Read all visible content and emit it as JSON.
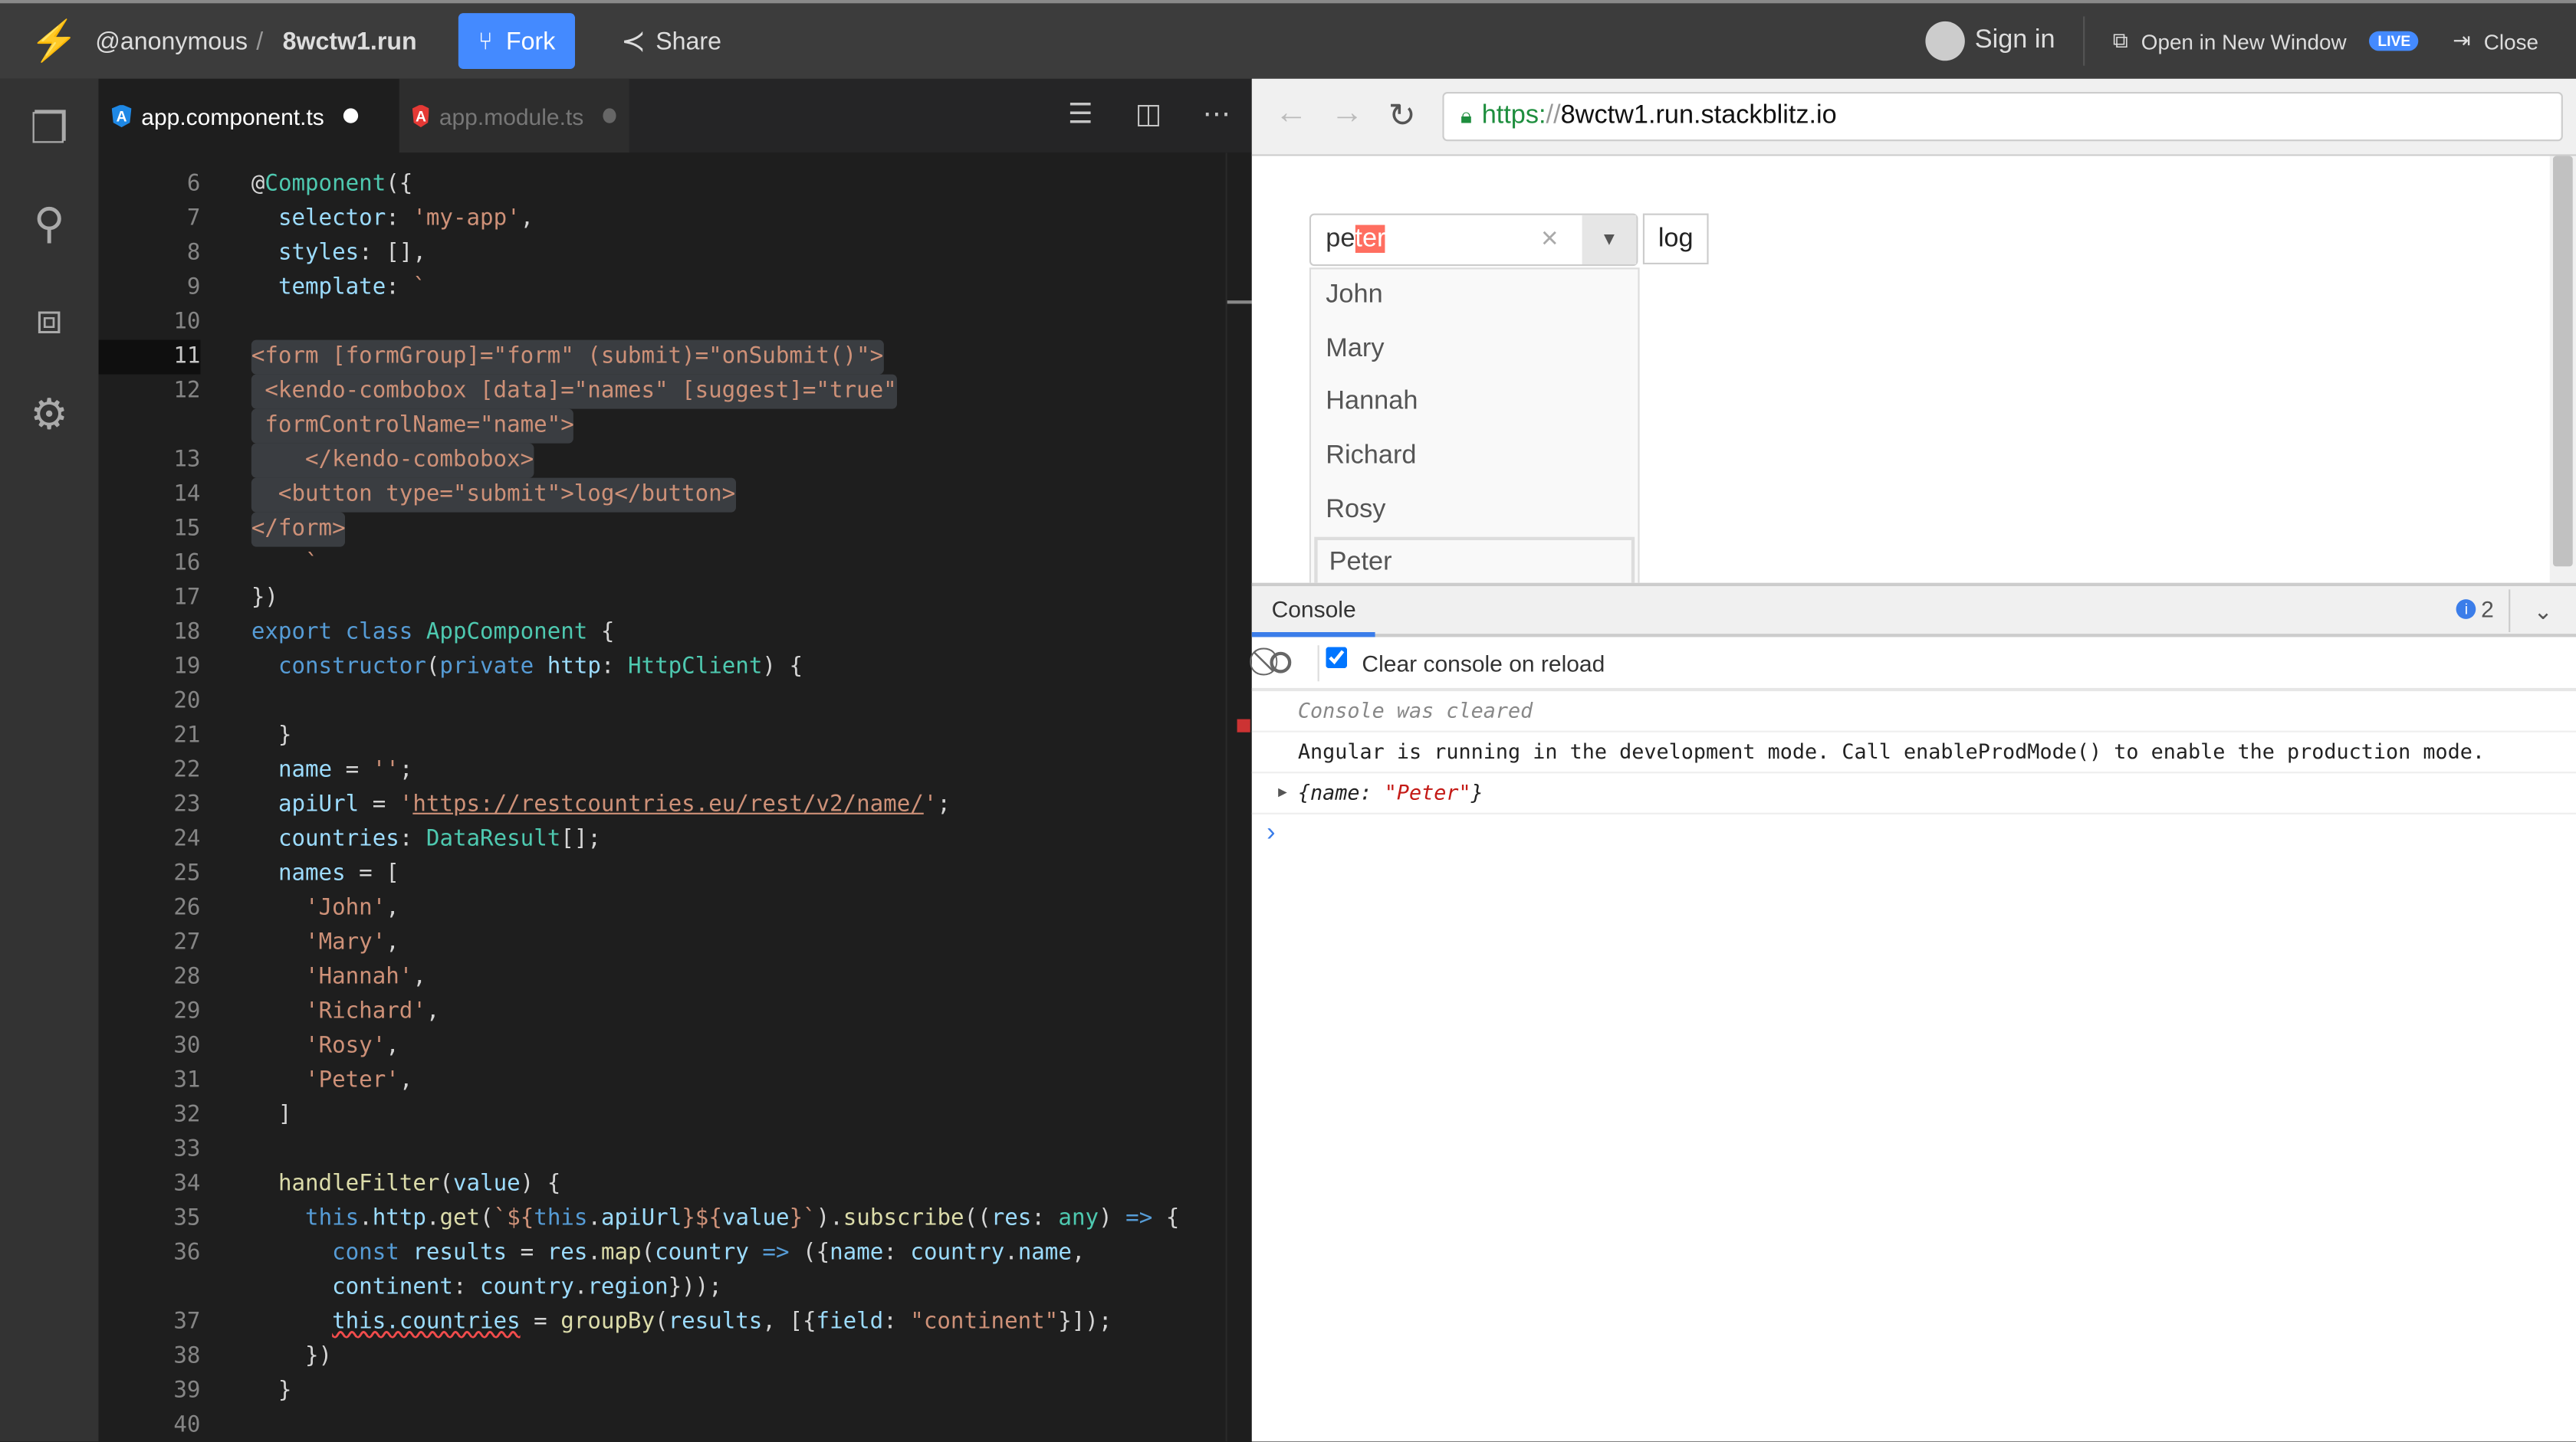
{
  "topbar": {
    "user": "@anonymous",
    "separator": "/",
    "project": "8wctw1.run",
    "fork_label": "Fork",
    "share_label": "Share",
    "signin_label": "Sign in",
    "open_window_label": "Open in New Window",
    "live_badge": "LIVE",
    "close_label": "Close"
  },
  "tabs": [
    {
      "label": "app.component.ts",
      "active": true,
      "icon_color": "#1e88e5"
    },
    {
      "label": "app.module.ts",
      "active": false,
      "icon_color": "#e53935"
    }
  ],
  "angular_icon_letter": "A",
  "editor": {
    "current_line": 11,
    "lines": [
      {
        "n": "6",
        "t": [
          [
            "@",
            "p"
          ],
          [
            "Component",
            "t"
          ],
          [
            "({",
            "p"
          ]
        ]
      },
      {
        "n": "7",
        "t": [
          [
            "  ",
            "p"
          ],
          [
            "selector",
            "v"
          ],
          [
            ": ",
            "p"
          ],
          [
            "'my-app'",
            "s"
          ],
          [
            ",",
            "p"
          ]
        ]
      },
      {
        "n": "8",
        "t": [
          [
            "  ",
            "p"
          ],
          [
            "styles",
            "v"
          ],
          [
            ": [],",
            "p"
          ]
        ]
      },
      {
        "n": "9",
        "t": [
          [
            "  ",
            "p"
          ],
          [
            "template",
            "v"
          ],
          [
            ": ",
            "p"
          ],
          [
            "`",
            "s"
          ]
        ]
      },
      {
        "n": "10",
        "t": []
      },
      {
        "n": "11",
        "sel": true,
        "t": [
          [
            "<form [formGroup]=\"form\" (submit)=\"onSubmit()\">",
            "s"
          ]
        ]
      },
      {
        "n": "12",
        "sel": true,
        "t": [
          [
            " <kendo-combobox [data]=\"names\" [suggest]=\"true\"",
            "s"
          ]
        ],
        "w": [
          [
            " formControlName=\"name\">",
            "s"
          ]
        ]
      },
      {
        "n": "13",
        "sel": true,
        "t": [
          [
            "    </kendo-combobox>",
            "s"
          ]
        ]
      },
      {
        "n": "14",
        "sel": true,
        "t": [
          [
            "  <button type=\"submit\">log</button>",
            "s"
          ]
        ]
      },
      {
        "n": "15",
        "sel": true,
        "t": [
          [
            "</form>",
            "s"
          ]
        ]
      },
      {
        "n": "16",
        "t": [
          [
            "    `",
            "s"
          ]
        ]
      },
      {
        "n": "17",
        "t": [
          [
            "})",
            "p"
          ]
        ]
      },
      {
        "n": "18",
        "t": [
          [
            "export ",
            "k"
          ],
          [
            "class ",
            "k"
          ],
          [
            "AppComponent",
            "t"
          ],
          [
            " {",
            "p"
          ]
        ]
      },
      {
        "n": "19",
        "t": [
          [
            "  ",
            "p"
          ],
          [
            "constructor",
            "k"
          ],
          [
            "(",
            "p"
          ],
          [
            "private ",
            "k"
          ],
          [
            "http",
            "v"
          ],
          [
            ": ",
            "p"
          ],
          [
            "HttpClient",
            "t"
          ],
          [
            ") {",
            "p"
          ]
        ]
      },
      {
        "n": "20",
        "t": []
      },
      {
        "n": "21",
        "t": [
          [
            "  }",
            "p"
          ]
        ]
      },
      {
        "n": "22",
        "t": [
          [
            "  ",
            "p"
          ],
          [
            "name",
            "v"
          ],
          [
            " = ",
            "p"
          ],
          [
            "''",
            "s"
          ],
          [
            ";",
            "p"
          ]
        ]
      },
      {
        "n": "23",
        "t": [
          [
            "  ",
            "p"
          ],
          [
            "apiUrl",
            "v"
          ],
          [
            " = ",
            "p"
          ],
          [
            "'",
            "s"
          ],
          [
            "https://restcountries.eu/rest/v2/name/",
            "u"
          ],
          [
            "'",
            "s"
          ],
          [
            ";",
            "p"
          ]
        ]
      },
      {
        "n": "24",
        "t": [
          [
            "  ",
            "p"
          ],
          [
            "countries",
            "v"
          ],
          [
            ": ",
            "p"
          ],
          [
            "DataResult",
            "t"
          ],
          [
            "[];",
            "p"
          ]
        ]
      },
      {
        "n": "25",
        "t": [
          [
            "  ",
            "p"
          ],
          [
            "names",
            "v"
          ],
          [
            " = [",
            "p"
          ]
        ]
      },
      {
        "n": "26",
        "t": [
          [
            "    ",
            "p"
          ],
          [
            "'John'",
            "s"
          ],
          [
            ",",
            "p"
          ]
        ]
      },
      {
        "n": "27",
        "t": [
          [
            "    ",
            "p"
          ],
          [
            "'Mary'",
            "s"
          ],
          [
            ",",
            "p"
          ]
        ]
      },
      {
        "n": "28",
        "t": [
          [
            "    ",
            "p"
          ],
          [
            "'Hannah'",
            "s"
          ],
          [
            ",",
            "p"
          ]
        ]
      },
      {
        "n": "29",
        "t": [
          [
            "    ",
            "p"
          ],
          [
            "'Richard'",
            "s"
          ],
          [
            ",",
            "p"
          ]
        ]
      },
      {
        "n": "30",
        "t": [
          [
            "    ",
            "p"
          ],
          [
            "'Rosy'",
            "s"
          ],
          [
            ",",
            "p"
          ]
        ]
      },
      {
        "n": "31",
        "t": [
          [
            "    ",
            "p"
          ],
          [
            "'Peter'",
            "s"
          ],
          [
            ",",
            "p"
          ]
        ]
      },
      {
        "n": "32",
        "t": [
          [
            "  ]",
            "p"
          ]
        ]
      },
      {
        "n": "33",
        "t": []
      },
      {
        "n": "34",
        "t": [
          [
            "  ",
            "p"
          ],
          [
            "handleFilter",
            "f"
          ],
          [
            "(",
            "p"
          ],
          [
            "value",
            "v"
          ],
          [
            ") {",
            "p"
          ]
        ]
      },
      {
        "n": "35",
        "t": [
          [
            "    ",
            "p"
          ],
          [
            "this",
            "k"
          ],
          [
            ".",
            "p"
          ],
          [
            "http",
            "v"
          ],
          [
            ".",
            "p"
          ],
          [
            "get",
            "f"
          ],
          [
            "(",
            "p"
          ],
          [
            "`${",
            "s"
          ],
          [
            "this",
            "k"
          ],
          [
            ".",
            "p"
          ],
          [
            "apiUrl",
            "v"
          ],
          [
            "}${",
            "s"
          ],
          [
            "value",
            "v"
          ],
          [
            "}`",
            "s"
          ],
          [
            ").",
            "p"
          ],
          [
            "subscribe",
            "f"
          ],
          [
            "((",
            "p"
          ],
          [
            "res",
            "v"
          ],
          [
            ": ",
            "p"
          ],
          [
            "any",
            "t"
          ],
          [
            ") ",
            "p"
          ],
          [
            "=>",
            "k"
          ],
          [
            " {",
            "p"
          ]
        ]
      },
      {
        "n": "36",
        "t": [
          [
            "      ",
            "p"
          ],
          [
            "const ",
            "k"
          ],
          [
            "results",
            "v"
          ],
          [
            " = ",
            "p"
          ],
          [
            "res",
            "v"
          ],
          [
            ".",
            "p"
          ],
          [
            "map",
            "f"
          ],
          [
            "(",
            "p"
          ],
          [
            "country",
            "v"
          ],
          [
            " ",
            "p"
          ],
          [
            "=>",
            "k"
          ],
          [
            " ({",
            "p"
          ],
          [
            "name",
            "v"
          ],
          [
            ": ",
            "p"
          ],
          [
            "country",
            "v"
          ],
          [
            ".",
            "p"
          ],
          [
            "name",
            "v"
          ],
          [
            ",",
            "p"
          ]
        ],
        "w": [
          [
            "      ",
            "p"
          ],
          [
            "continent",
            "v"
          ],
          [
            ": ",
            "p"
          ],
          [
            "country",
            "v"
          ],
          [
            ".",
            "p"
          ],
          [
            "region",
            "v"
          ],
          [
            "}));",
            "p"
          ]
        ]
      },
      {
        "n": "37",
        "t": [
          [
            "      ",
            "p"
          ],
          [
            "this.countries",
            "e"
          ],
          [
            " = ",
            "p"
          ],
          [
            "groupBy",
            "f"
          ],
          [
            "(",
            "p"
          ],
          [
            "results",
            "v"
          ],
          [
            ", [{",
            "p"
          ],
          [
            "field",
            "v"
          ],
          [
            ": ",
            "p"
          ],
          [
            "\"continent\"",
            "s"
          ],
          [
            "}]);",
            "p"
          ]
        ]
      },
      {
        "n": "38",
        "t": [
          [
            "    })",
            "p"
          ]
        ]
      },
      {
        "n": "39",
        "t": [
          [
            "  }",
            "p"
          ]
        ]
      },
      {
        "n": "40",
        "t": []
      }
    ]
  },
  "browser": {
    "url_scheme": "https:",
    "url_sep": "//",
    "url_host": "8wctw1.run.stackblitz.io"
  },
  "preview": {
    "combo_typed": "pe",
    "combo_suggest": "ter",
    "clear_glyph": "×",
    "dropdown_glyph": "▼",
    "log_button": "log",
    "options": [
      "John",
      "Mary",
      "Hannah",
      "Richard",
      "Rosy",
      "Peter"
    ],
    "focused_option": "Peter"
  },
  "console": {
    "tab_label": "Console",
    "info_count": "2",
    "clear_on_reload_label": "Clear console on reload",
    "clear_on_reload_checked": true,
    "cleared_msg": "Console was cleared",
    "angular_msg": "Angular is running in the development mode. Call enableProdMode() to enable the production mode.",
    "obj_key": "{name: ",
    "obj_value": "\"Peter\"",
    "obj_close": "}",
    "prompt": "›"
  },
  "colors": {
    "accent": "#448aff",
    "editor_bg": "#1e1e1e",
    "string": "#ce9178"
  }
}
